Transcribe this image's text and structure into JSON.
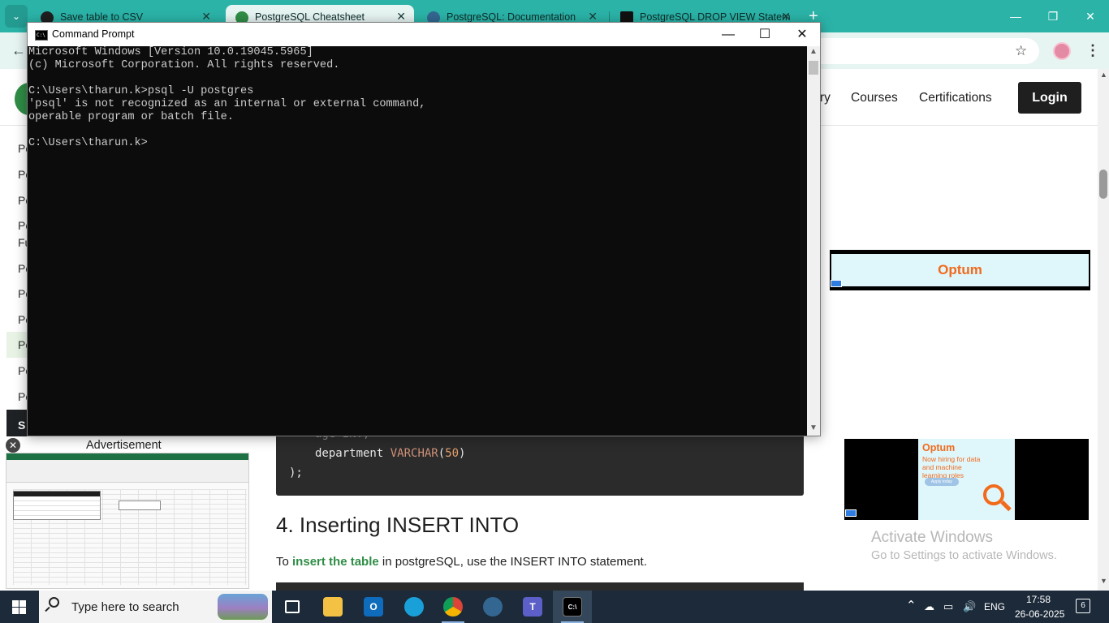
{
  "browser": {
    "tabs": [
      {
        "label": "Save table to CSV",
        "active": false
      },
      {
        "label": "PostgreSQL Cheatsheet",
        "active": true
      },
      {
        "label": "PostgreSQL: Documentation",
        "active": false
      },
      {
        "label": "PostgreSQL DROP VIEW Statem",
        "active": false
      }
    ],
    "new_tab": "+",
    "close_glyph": "✕",
    "min_glyph": "—",
    "restore_glyph": "❐",
    "win_close_glyph": "✕",
    "back_glyph": "←",
    "star_glyph": "☆",
    "menu_glyph": "⋮",
    "tablist_glyph": "⌄",
    "accent_color": "#2bb3a8"
  },
  "site": {
    "nav": {
      "partial": "ry",
      "courses": "Courses",
      "certifications": "Certifications",
      "login": "Login"
    },
    "sidebar_items": [
      "Po",
      "Po",
      "Po",
      "Po",
      "Fu",
      "Po",
      "Po",
      "Po",
      "Po",
      "Po",
      "Po"
    ],
    "sidebar_dark": "S",
    "advertisement_label": "Advertisement",
    "ad_close_glyph": "✕",
    "code_block": {
      "line1_partial": "age INT,",
      "line2_name": "department",
      "line2_type": "VARCHAR",
      "line2_open": "(",
      "line2_num": "50",
      "line2_close": ")",
      "line3": ");"
    },
    "section_heading": "4. Inserting INSERT INTO",
    "section_text_before": "To ",
    "section_text_link": "insert the table",
    "section_text_after": " in postgreSQL, use the INSERT INTO statement.",
    "ad_optum": {
      "brand": "Optum",
      "headline": "Now hiring for data and machine learning roles",
      "cta": "Apply today"
    },
    "watermark": {
      "title": "Activate Windows",
      "subtitle": "Go to Settings to activate Windows."
    }
  },
  "cmd": {
    "title": "Command Prompt",
    "icon_text": "C:\\",
    "lines": [
      "Microsoft Windows [Version 10.0.19045.5965]",
      "(c) Microsoft Corporation. All rights reserved.",
      "",
      "C:\\Users\\tharun.k>psql -U postgres",
      "'psql' is not recognized as an internal or external command,",
      "operable program or batch file.",
      "",
      "C:\\Users\\tharun.k>"
    ],
    "min_glyph": "—",
    "max_glyph": "☐",
    "close_glyph": "✕",
    "scroll_up": "▲",
    "scroll_down": "▼"
  },
  "taskbar": {
    "search_placeholder": "Type here to search",
    "apps": [
      "task-view",
      "file-explorer",
      "outlook",
      "edge",
      "chrome",
      "pgadmin",
      "teams",
      "command-prompt"
    ],
    "tray": {
      "chevron": "⌃",
      "language": "ENG",
      "time": "17:58",
      "date": "26-06-2025",
      "notifications": "6"
    }
  }
}
